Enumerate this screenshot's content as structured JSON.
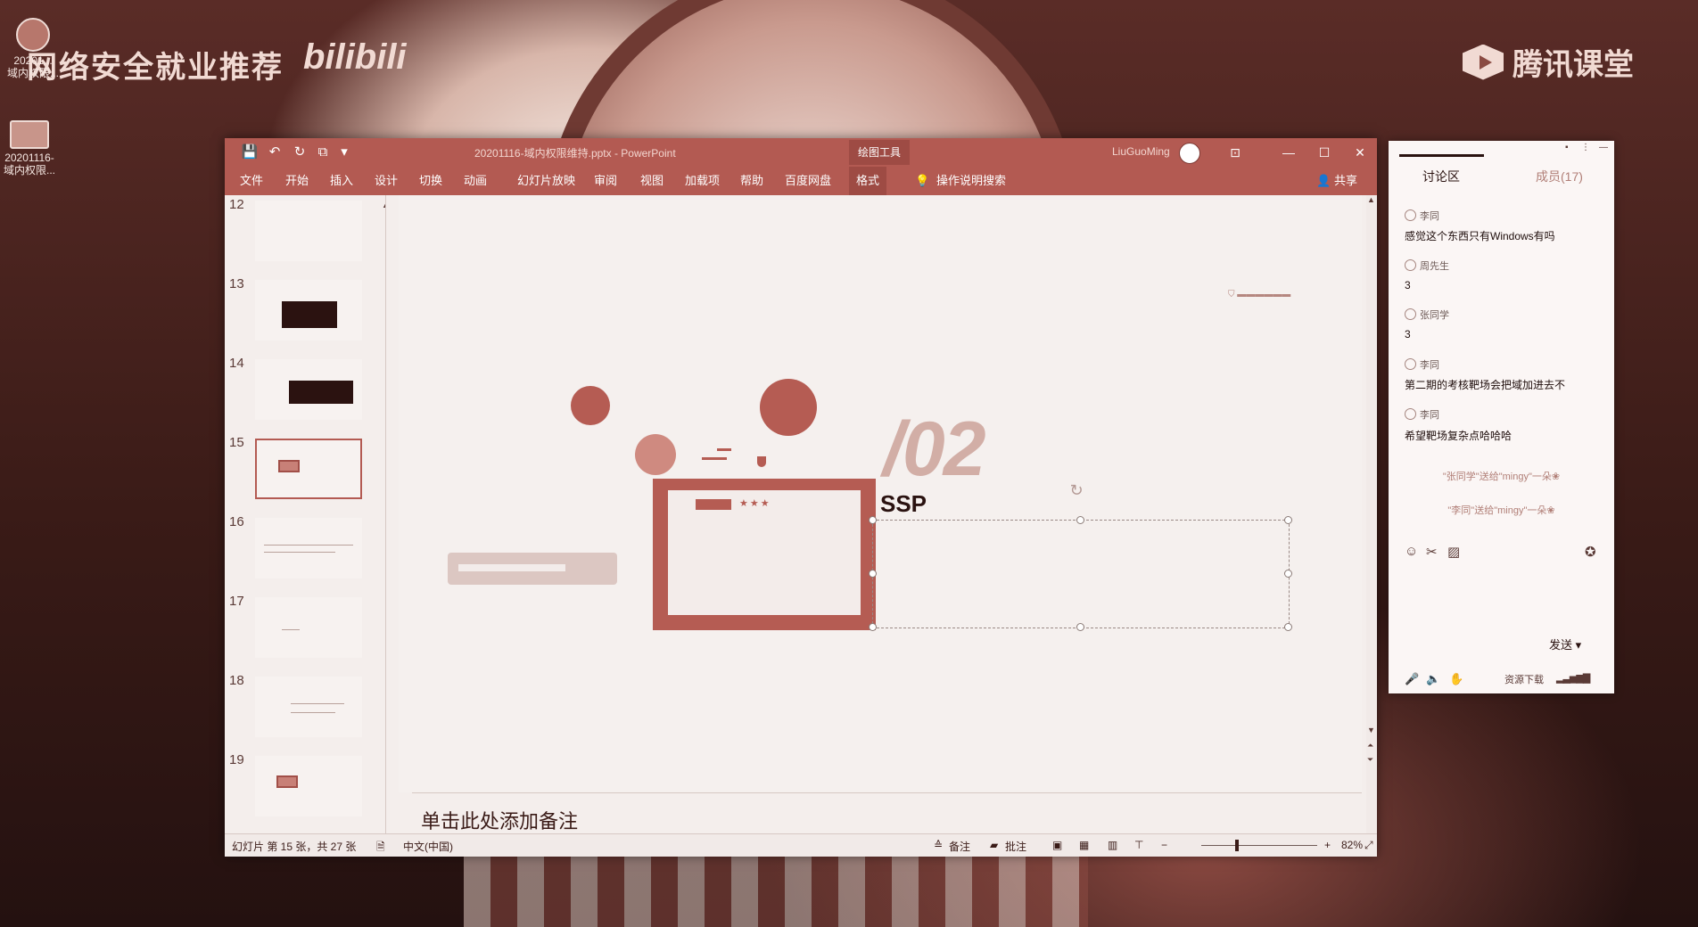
{
  "watermark": {
    "left_text": "网络安全就业推荐",
    "bili": "bilibili",
    "right_text": "腾讯课堂"
  },
  "desktop_icons": [
    {
      "label": "20201...\n域内权限..."
    },
    {
      "label": "20201116-\n域内权限..."
    }
  ],
  "ppt": {
    "title": "20201116-域内权限维持.pptx - PowerPoint",
    "context_tool": "绘图工具",
    "user": "LiuGuoMing",
    "quick_access": [
      "💾",
      "↶",
      "↻",
      "⧉",
      "▾"
    ],
    "window_controls": [
      "⊡",
      "—",
      "☐",
      "✕"
    ],
    "tabs": [
      "文件",
      "开始",
      "插入",
      "设计",
      "切换",
      "动画",
      "幻灯片放映",
      "审阅",
      "视图",
      "加载项",
      "帮助",
      "百度网盘",
      "格式"
    ],
    "tell_me": "操作说明搜索",
    "share": "共享",
    "thumbs": [
      {
        "num": "12"
      },
      {
        "num": "13"
      },
      {
        "num": "14"
      },
      {
        "num": "15"
      },
      {
        "num": "16"
      },
      {
        "num": "17"
      },
      {
        "num": "18"
      },
      {
        "num": "19"
      }
    ],
    "slide": {
      "big_number": "/02",
      "title": "SSP"
    },
    "notes_placeholder": "单击此处添加备注",
    "status": {
      "slide_info": "幻灯片 第 15 张，共 27 张",
      "language": "中文(中国)",
      "notes_btn": "备注",
      "comments_btn": "批注",
      "zoom": "82%"
    }
  },
  "chat": {
    "tab_discussion": "讨论区",
    "tab_members": "成员(17)",
    "messages": [
      {
        "name": "李同",
        "text": "感觉这个东西只有Windows有吗"
      },
      {
        "name": "周先生",
        "text": "3"
      },
      {
        "name": "张同学",
        "text": "3"
      },
      {
        "name": "李同",
        "text": "第二期的考核靶场会把域加进去不"
      },
      {
        "name": "李同",
        "text": "希望靶场复杂点哈哈哈"
      }
    ],
    "system": [
      "\"张同学\"送给\"mingy\"一朵❀",
      "\"李同\"送给\"mingy\"一朵❀"
    ],
    "send": "发送",
    "bottom_label": "资源下载"
  }
}
